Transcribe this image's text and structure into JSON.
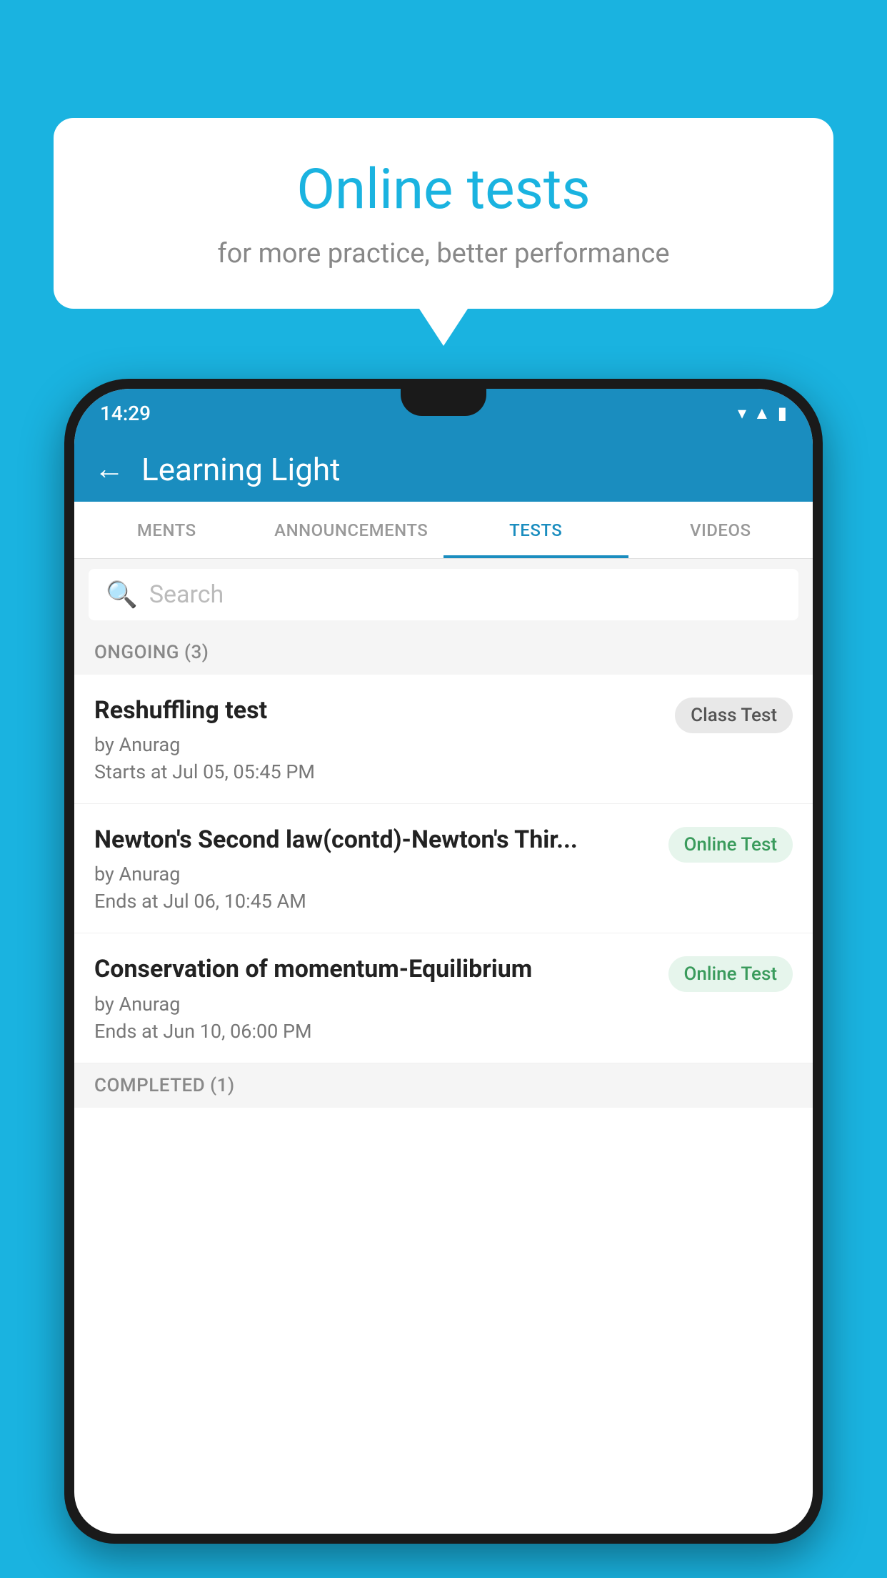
{
  "background": {
    "color": "#1ab3e0"
  },
  "speech_bubble": {
    "title": "Online tests",
    "subtitle": "for more practice, better performance"
  },
  "phone": {
    "status_bar": {
      "time": "14:29"
    },
    "header": {
      "title": "Learning Light",
      "back_label": "←"
    },
    "tabs": [
      {
        "label": "MENTS",
        "active": false
      },
      {
        "label": "ANNOUNCEMENTS",
        "active": false
      },
      {
        "label": "TESTS",
        "active": true
      },
      {
        "label": "VIDEOS",
        "active": false
      }
    ],
    "search": {
      "placeholder": "Search"
    },
    "ongoing_section": {
      "label": "ONGOING (3)"
    },
    "tests": [
      {
        "name": "Reshuffling test",
        "by": "by Anurag",
        "date_label": "Starts at",
        "date": "Jul 05, 05:45 PM",
        "badge": "Class Test",
        "badge_type": "class"
      },
      {
        "name": "Newton's Second law(contd)-Newton's Thir...",
        "by": "by Anurag",
        "date_label": "Ends at",
        "date": "Jul 06, 10:45 AM",
        "badge": "Online Test",
        "badge_type": "online"
      },
      {
        "name": "Conservation of momentum-Equilibrium",
        "by": "by Anurag",
        "date_label": "Ends at",
        "date": "Jun 10, 06:00 PM",
        "badge": "Online Test",
        "badge_type": "online"
      }
    ],
    "completed_section": {
      "label": "COMPLETED (1)"
    }
  }
}
